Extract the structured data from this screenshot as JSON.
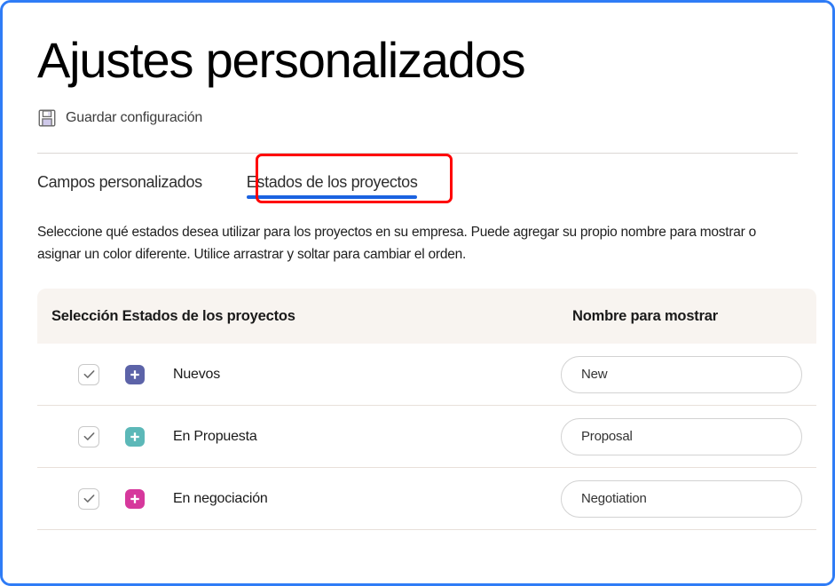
{
  "page": {
    "title": "Ajustes personalizados"
  },
  "toolbar": {
    "save_icon": "floppy-disk-save-icon",
    "save_label": "Guardar configuración"
  },
  "tabs": [
    {
      "label": "Campos personalizados",
      "active": false
    },
    {
      "label": "Estados de los proyectos",
      "active": true
    }
  ],
  "annotation": {
    "type": "red-highlight-box",
    "target": "Estados de los proyectos",
    "color": "#ff0000"
  },
  "description": "Seleccione qué estados desea utilizar para los proyectos en su empresa. Puede agregar su propio nombre para mostrar o asignar un color diferente. Utilice arrastrar y soltar para cambiar el orden.",
  "table": {
    "headers": {
      "selection": "Selección Estados de los proyectos",
      "display_name": "Nombre para mostrar"
    },
    "header_background": "#f8f4f0",
    "rows": [
      {
        "checked": true,
        "swatch_color": "#5c63a8",
        "swatch_icon": "plus-icon",
        "status": "Nuevos",
        "display_name": "New"
      },
      {
        "checked": true,
        "swatch_color": "#5cb8b8",
        "swatch_icon": "plus-icon",
        "status": "En Propuesta",
        "display_name": "Proposal"
      },
      {
        "checked": true,
        "swatch_color": "#d6389c",
        "swatch_icon": "plus-icon",
        "status": "En negociación",
        "display_name": "Negotiation"
      }
    ]
  },
  "colors": {
    "tab_underline": "#1a62e0",
    "viewport_border": "#2f7cf6",
    "row_divider": "#e8e0da"
  }
}
